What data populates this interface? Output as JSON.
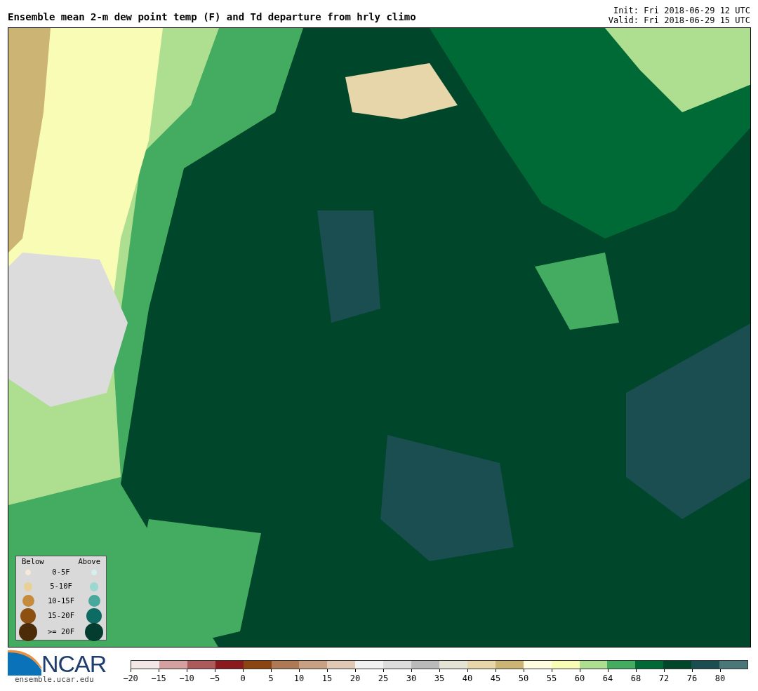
{
  "title": "Ensemble mean 2-m dew point temp (F) and Td departure from hrly climo",
  "init": "Init: Fri 2018-06-29 12 UTC",
  "valid": "Valid: Fri 2018-06-29 15 UTC",
  "legend": {
    "below_heading": "Below",
    "above_heading": "Above",
    "rows": [
      {
        "label": "0-5F",
        "below": {
          "color": "#f4ead8"
        },
        "above": {
          "color": "#d8eeee"
        }
      },
      {
        "label": "5-10F",
        "below": {
          "color": "#e8d098"
        },
        "above": {
          "color": "#9cd8d0"
        }
      },
      {
        "label": "10-15F",
        "below": {
          "color": "#c48c3c"
        },
        "above": {
          "color": "#48a89c"
        }
      },
      {
        "label": "15-20F",
        "below": {
          "color": "#8c5010"
        },
        "above": {
          "color": "#0c6c64"
        }
      },
      {
        "label": ">= 20F",
        "below": {
          "color": "#4c2c08"
        },
        "above": {
          "color": "#043c30"
        }
      }
    ]
  },
  "logo": {
    "name": "NCAR",
    "url": "ensemble.ucar.edu"
  },
  "colorbar": {
    "bins": [
      {
        "color": "#f3e6e6"
      },
      {
        "color": "#d4a0a0"
      },
      {
        "color": "#ad5a5a"
      },
      {
        "color": "#8b1a1e"
      },
      {
        "color": "#8b4512"
      },
      {
        "color": "#ad7a55"
      },
      {
        "color": "#c8a184"
      },
      {
        "color": "#e0c8b4"
      },
      {
        "color": "#f2f2f2"
      },
      {
        "color": "#dcdcdc"
      },
      {
        "color": "#bababa"
      },
      {
        "color": "#e3e4d4"
      },
      {
        "color": "#e6d6aa"
      },
      {
        "color": "#ccb474"
      },
      {
        "color": "#fffde0"
      },
      {
        "color": "#f8fcb4"
      },
      {
        "color": "#aede90"
      },
      {
        "color": "#44ac60"
      },
      {
        "color": "#006a36"
      },
      {
        "color": "#00462a"
      },
      {
        "color": "#1a4e50"
      },
      {
        "color": "#4a7878"
      }
    ],
    "ticks": [
      "−20",
      "−15",
      "−10",
      "−5",
      "0",
      "5",
      "10",
      "15",
      "20",
      "25",
      "30",
      "35",
      "40",
      "45",
      "50",
      "55",
      "60",
      "64",
      "68",
      "72",
      "76",
      "80"
    ]
  }
}
